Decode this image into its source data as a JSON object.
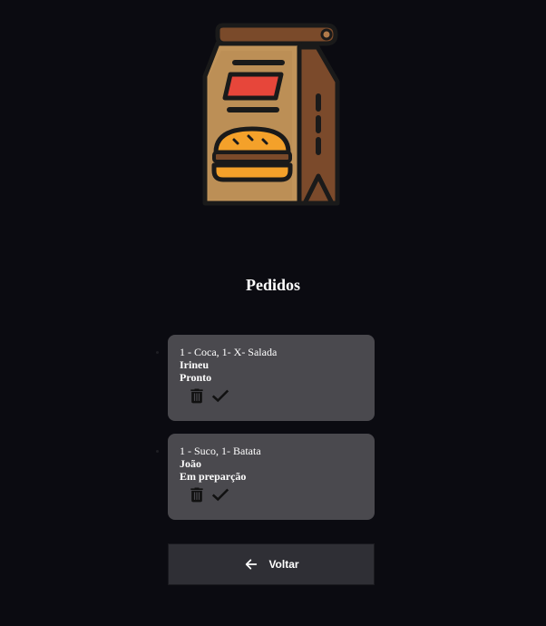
{
  "header": {
    "logo_icon": "food-delivery-bag-icon",
    "title": "Pedidos"
  },
  "orders": [
    {
      "items": "1 - Coca, 1- X- Salada",
      "customer": "Irineu",
      "status": "Pronto",
      "delete_icon": "trash-icon",
      "done_icon": "check-icon"
    },
    {
      "items": "1 - Suco, 1- Batata",
      "customer": "João",
      "status": "Em preparção",
      "delete_icon": "trash-icon",
      "done_icon": "check-icon"
    }
  ],
  "footer": {
    "back_label": "Voltar",
    "back_icon": "arrow-left-icon"
  },
  "colors": {
    "background": "#0b0b11",
    "card": "#4a494e",
    "button": "#2f2f35",
    "text": "#ffffff"
  }
}
